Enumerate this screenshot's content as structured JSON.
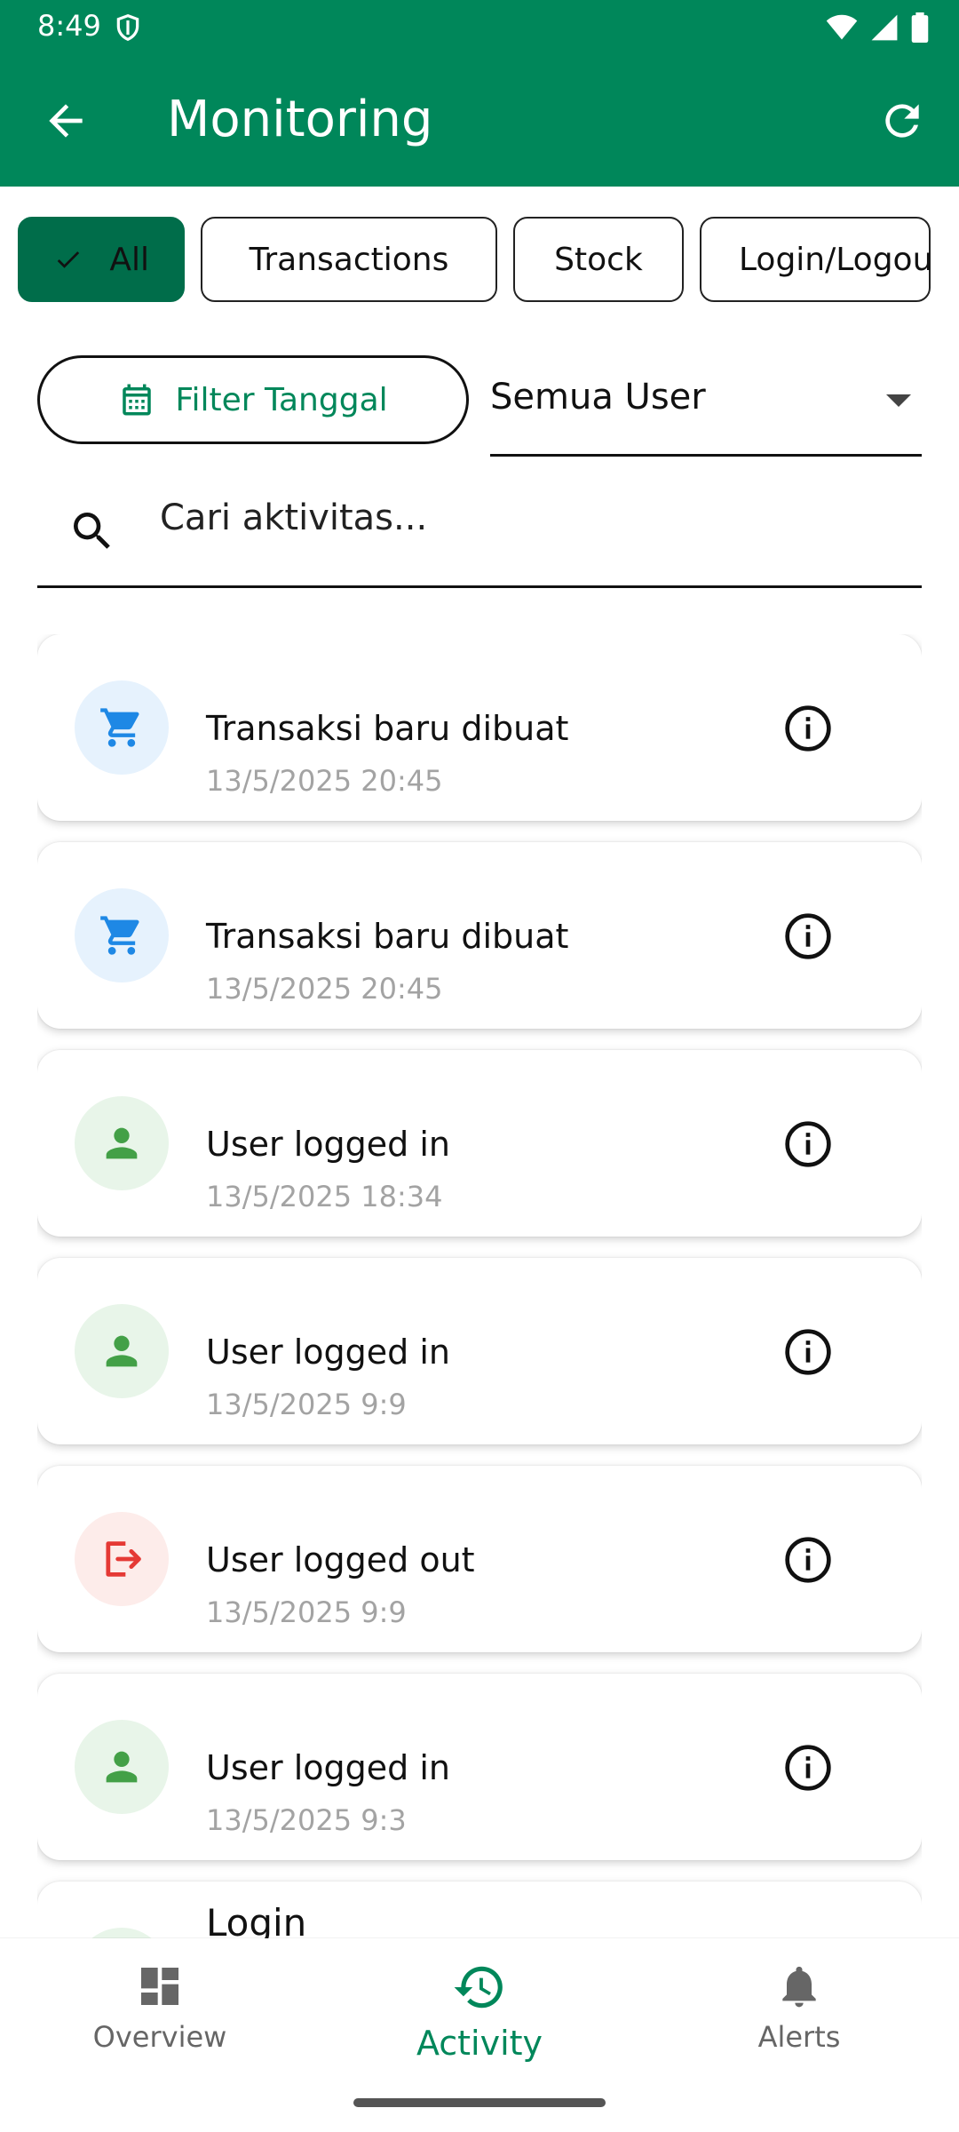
{
  "status_bar": {
    "time": "8:49"
  },
  "app_bar": {
    "title": "Monitoring"
  },
  "filter_chips": [
    {
      "label": "All",
      "selected": true
    },
    {
      "label": "Transactions",
      "selected": false
    },
    {
      "label": "Stock",
      "selected": false
    },
    {
      "label": "Login/Logou",
      "selected": false
    }
  ],
  "date_filter": {
    "label": "Filter Tanggal"
  },
  "user_select": {
    "value": "Semua User"
  },
  "search": {
    "placeholder": "Cari aktivitas..."
  },
  "activities": [
    {
      "title": "Transaksi baru dibuat",
      "timestamp": "13/5/2025 20:45",
      "icon": "cart-icon"
    },
    {
      "title": "Transaksi baru dibuat",
      "timestamp": "13/5/2025 20:45",
      "icon": "cart-icon"
    },
    {
      "title": "User logged in",
      "timestamp": "13/5/2025 18:34",
      "icon": "person-icon"
    },
    {
      "title": "User logged in",
      "timestamp": "13/5/2025 9:9",
      "icon": "person-icon"
    },
    {
      "title": "User logged out",
      "timestamp": "13/5/2025 9:9",
      "icon": "logout-icon"
    },
    {
      "title": "User logged in",
      "timestamp": "13/5/2025 9:3",
      "icon": "person-icon"
    },
    {
      "title": "Login",
      "timestamp": "",
      "icon": "person-icon"
    }
  ],
  "bottom_nav": [
    {
      "label": "Overview",
      "icon": "dashboard-icon",
      "active": false
    },
    {
      "label": "Activity",
      "icon": "history-icon",
      "active": true
    },
    {
      "label": "Alerts",
      "icon": "bell-icon",
      "active": false
    }
  ],
  "colors": {
    "primary": "#00875a",
    "chip_selected": "#006d4a",
    "cart_bg": "#e6f2fd",
    "cart_fg": "#1e88e5",
    "person_bg": "#e8f5e9",
    "person_fg": "#43a047",
    "logout_bg": "#fdecea",
    "logout_fg": "#e53935"
  }
}
